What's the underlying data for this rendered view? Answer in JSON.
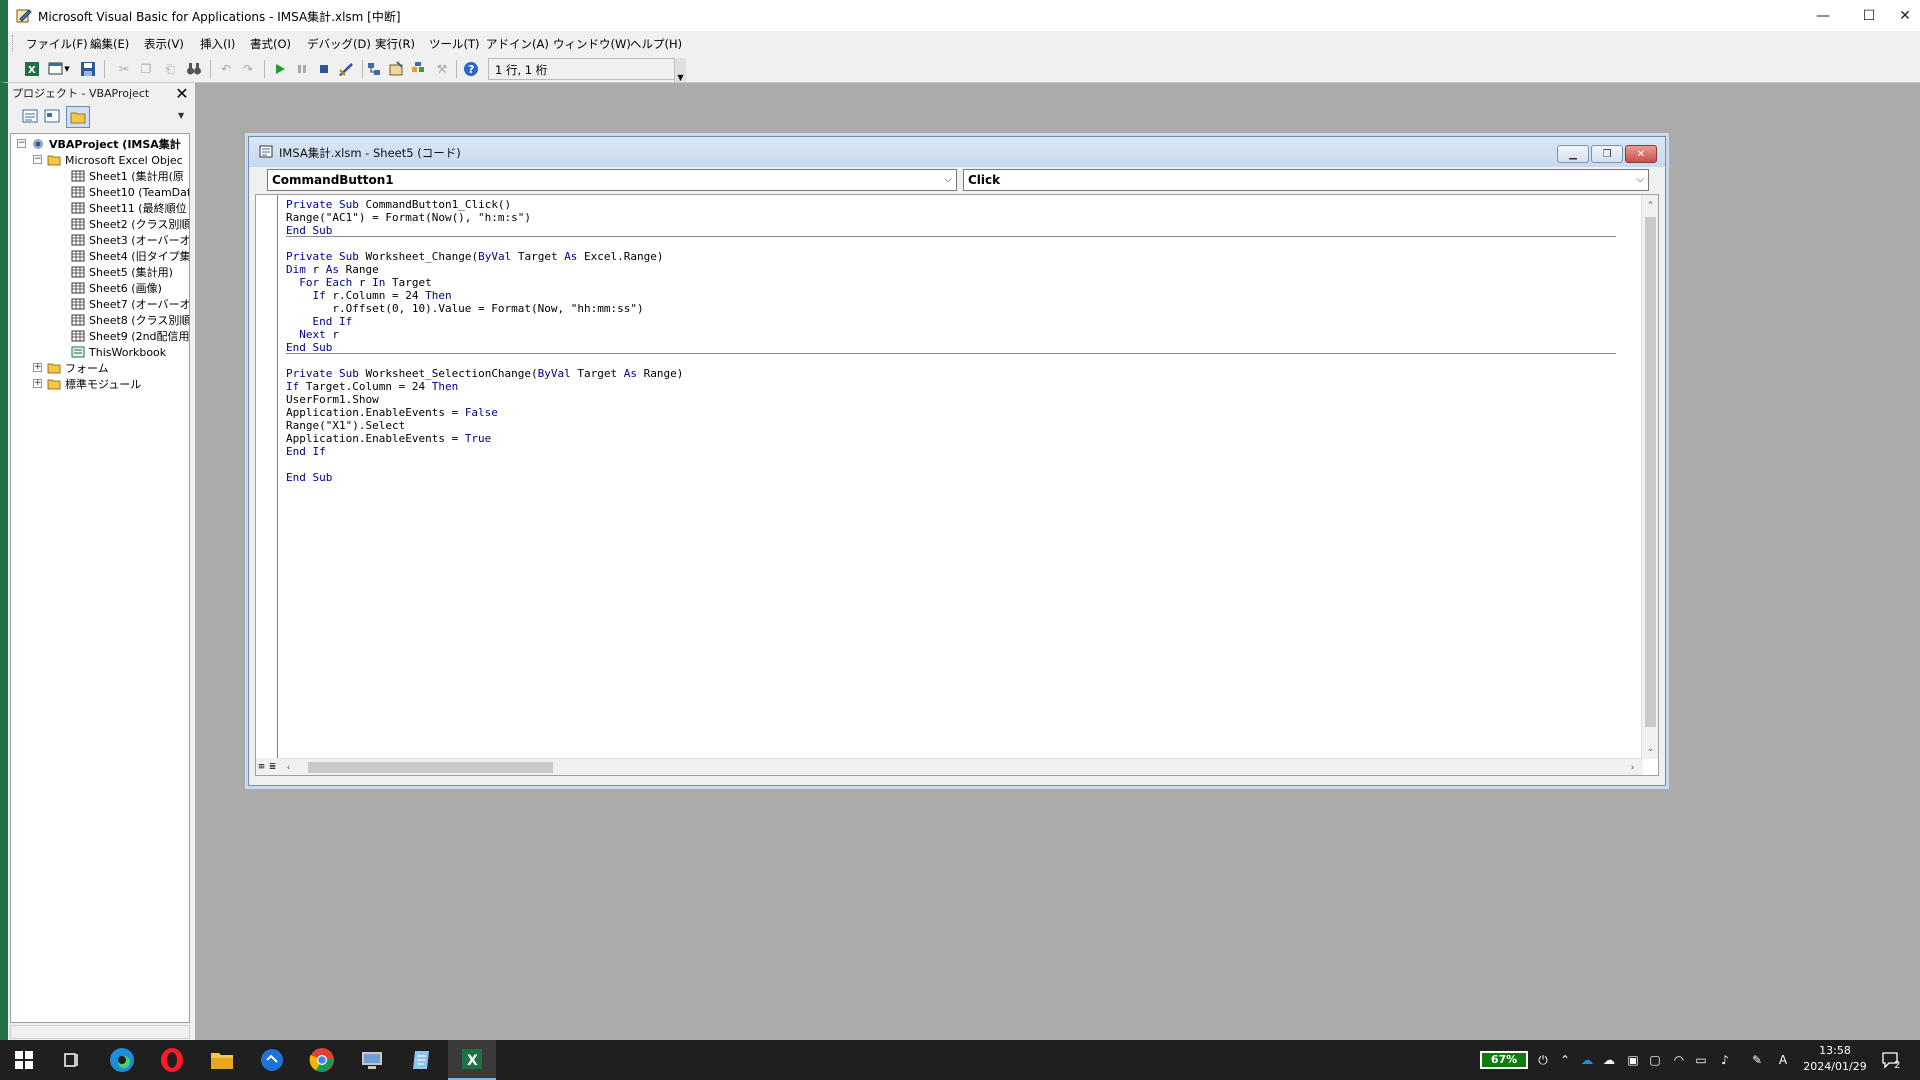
{
  "window": {
    "title": "Microsoft Visual Basic for Applications - IMSA集計.xlsm [中断]"
  },
  "menu": [
    "ファイル(F)",
    "編集(E)",
    "表示(V)",
    "挿入(I)",
    "書式(O)",
    "デバッグ(D)",
    "実行(R)",
    "ツール(T)",
    "アドイン(A)",
    "ウィンドウ(W)",
    "ヘルプ(H)"
  ],
  "toolbar": {
    "cursor_position": "1 行, 1 桁"
  },
  "project": {
    "title": "プロジェクト - VBAProject",
    "root": "VBAProject (IMSA集計",
    "excel_objects": "Microsoft Excel Objec",
    "sheets": [
      "Sheet1 (集計用(原",
      "Sheet10 (TeamDat",
      "Sheet11 (最終順位",
      "Sheet2 (クラス別順(",
      "Sheet3 (オーバーオ-",
      "Sheet4 (旧タイプ集(",
      "Sheet5 (集計用)",
      "Sheet6 (画像)",
      "Sheet7 (オーバーオ-",
      "Sheet8 (クラス別順(",
      "Sheet9 (2nd配信用"
    ],
    "workbook": "ThisWorkbook",
    "forms": "フォーム",
    "modules": "標準モジュール"
  },
  "code_window": {
    "title": "IMSA集計.xlsm - Sheet5 (コード)",
    "object_combo": "CommandButton1",
    "proc_combo": "Click",
    "lines": [
      [
        {
          "t": "Private Sub ",
          "k": 1
        },
        {
          "t": "CommandButton1_Click()"
        }
      ],
      [
        {
          "t": "Range(\"AC1\") = Format(Now(), \"h:m:s\")"
        }
      ],
      [
        {
          "t": "End Sub",
          "k": 1
        }
      ],
      [
        {
          "t": ""
        }
      ],
      [
        {
          "t": "Private Sub ",
          "k": 1
        },
        {
          "t": "Worksheet_Change("
        },
        {
          "t": "ByVal",
          "k": 1
        },
        {
          "t": " Target "
        },
        {
          "t": "As",
          "k": 1
        },
        {
          "t": " Excel.Range)"
        }
      ],
      [
        {
          "t": "Dim",
          "k": 1
        },
        {
          "t": " r "
        },
        {
          "t": "As",
          "k": 1
        },
        {
          "t": " Range"
        }
      ],
      [
        {
          "t": "  "
        },
        {
          "t": "For Each",
          "k": 1
        },
        {
          "t": " r "
        },
        {
          "t": "In",
          "k": 1
        },
        {
          "t": " Target"
        }
      ],
      [
        {
          "t": "    "
        },
        {
          "t": "If",
          "k": 1
        },
        {
          "t": " r.Column = 24 "
        },
        {
          "t": "Then",
          "k": 1
        }
      ],
      [
        {
          "t": "       r.Offset(0, 10).Value = Format(Now, \"hh:mm:ss\")"
        }
      ],
      [
        {
          "t": "    "
        },
        {
          "t": "End If",
          "k": 1
        }
      ],
      [
        {
          "t": "  "
        },
        {
          "t": "Next",
          "k": 1
        },
        {
          "t": " r"
        }
      ],
      [
        {
          "t": "End Sub",
          "k": 1
        }
      ],
      [
        {
          "t": ""
        }
      ],
      [
        {
          "t": "Private Sub ",
          "k": 1
        },
        {
          "t": "Worksheet_SelectionChange("
        },
        {
          "t": "ByVal",
          "k": 1
        },
        {
          "t": " Target "
        },
        {
          "t": "As",
          "k": 1
        },
        {
          "t": " Range)"
        }
      ],
      [
        {
          "t": "If",
          "k": 1
        },
        {
          "t": " Target.Column = 24 "
        },
        {
          "t": "Then",
          "k": 1
        }
      ],
      [
        {
          "t": "UserForm1.Show"
        }
      ],
      [
        {
          "t": "Application.EnableEvents = "
        },
        {
          "t": "False",
          "k": 1
        }
      ],
      [
        {
          "t": "Range(\"X1\").Select"
        }
      ],
      [
        {
          "t": "Application.EnableEvents = "
        },
        {
          "t": "True",
          "k": 1
        }
      ],
      [
        {
          "t": "End If",
          "k": 1
        }
      ],
      [
        {
          "t": ""
        }
      ],
      [
        {
          "t": "End Sub",
          "k": 1
        }
      ]
    ]
  },
  "taskbar": {
    "battery": "67%",
    "ime": "A",
    "time": "13:58",
    "date": "2024/01/29",
    "notifications": "2"
  }
}
